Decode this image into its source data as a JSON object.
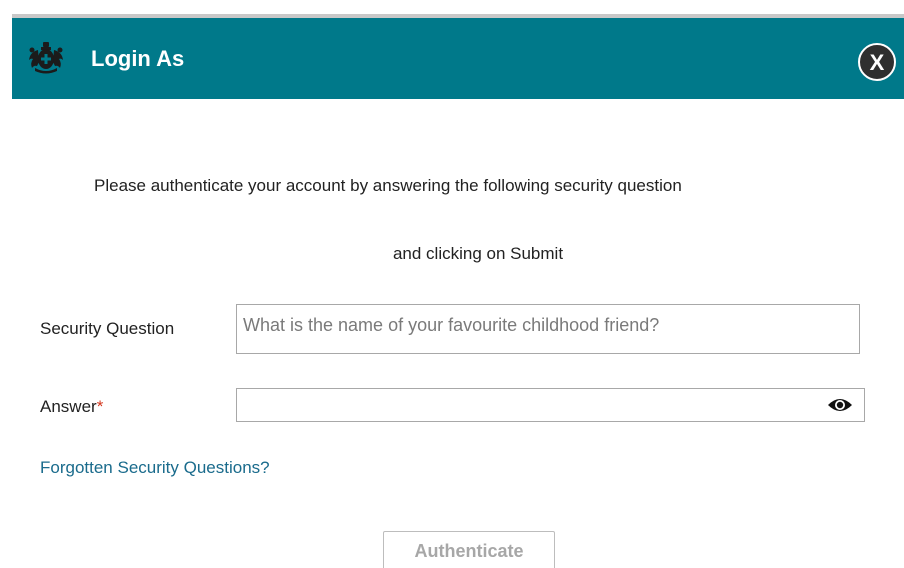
{
  "dialog": {
    "title": "Login As",
    "close_label": "X"
  },
  "instructions": {
    "line1": "Please authenticate your account by answering the following security question",
    "line2": "and clicking on Submit"
  },
  "security_question": {
    "label": "Security Question",
    "value": "What is the name of your favourite childhood friend?"
  },
  "answer": {
    "label": "Answer",
    "required_marker": "*",
    "value": "",
    "toggle_icon": "eye-icon"
  },
  "links": {
    "forgotten": "Forgotten Security Questions?"
  },
  "actions": {
    "authenticate_label": "Authenticate"
  },
  "colors": {
    "header_bg": "#00798a",
    "link": "#1a6b8c",
    "required": "#d4351c"
  }
}
